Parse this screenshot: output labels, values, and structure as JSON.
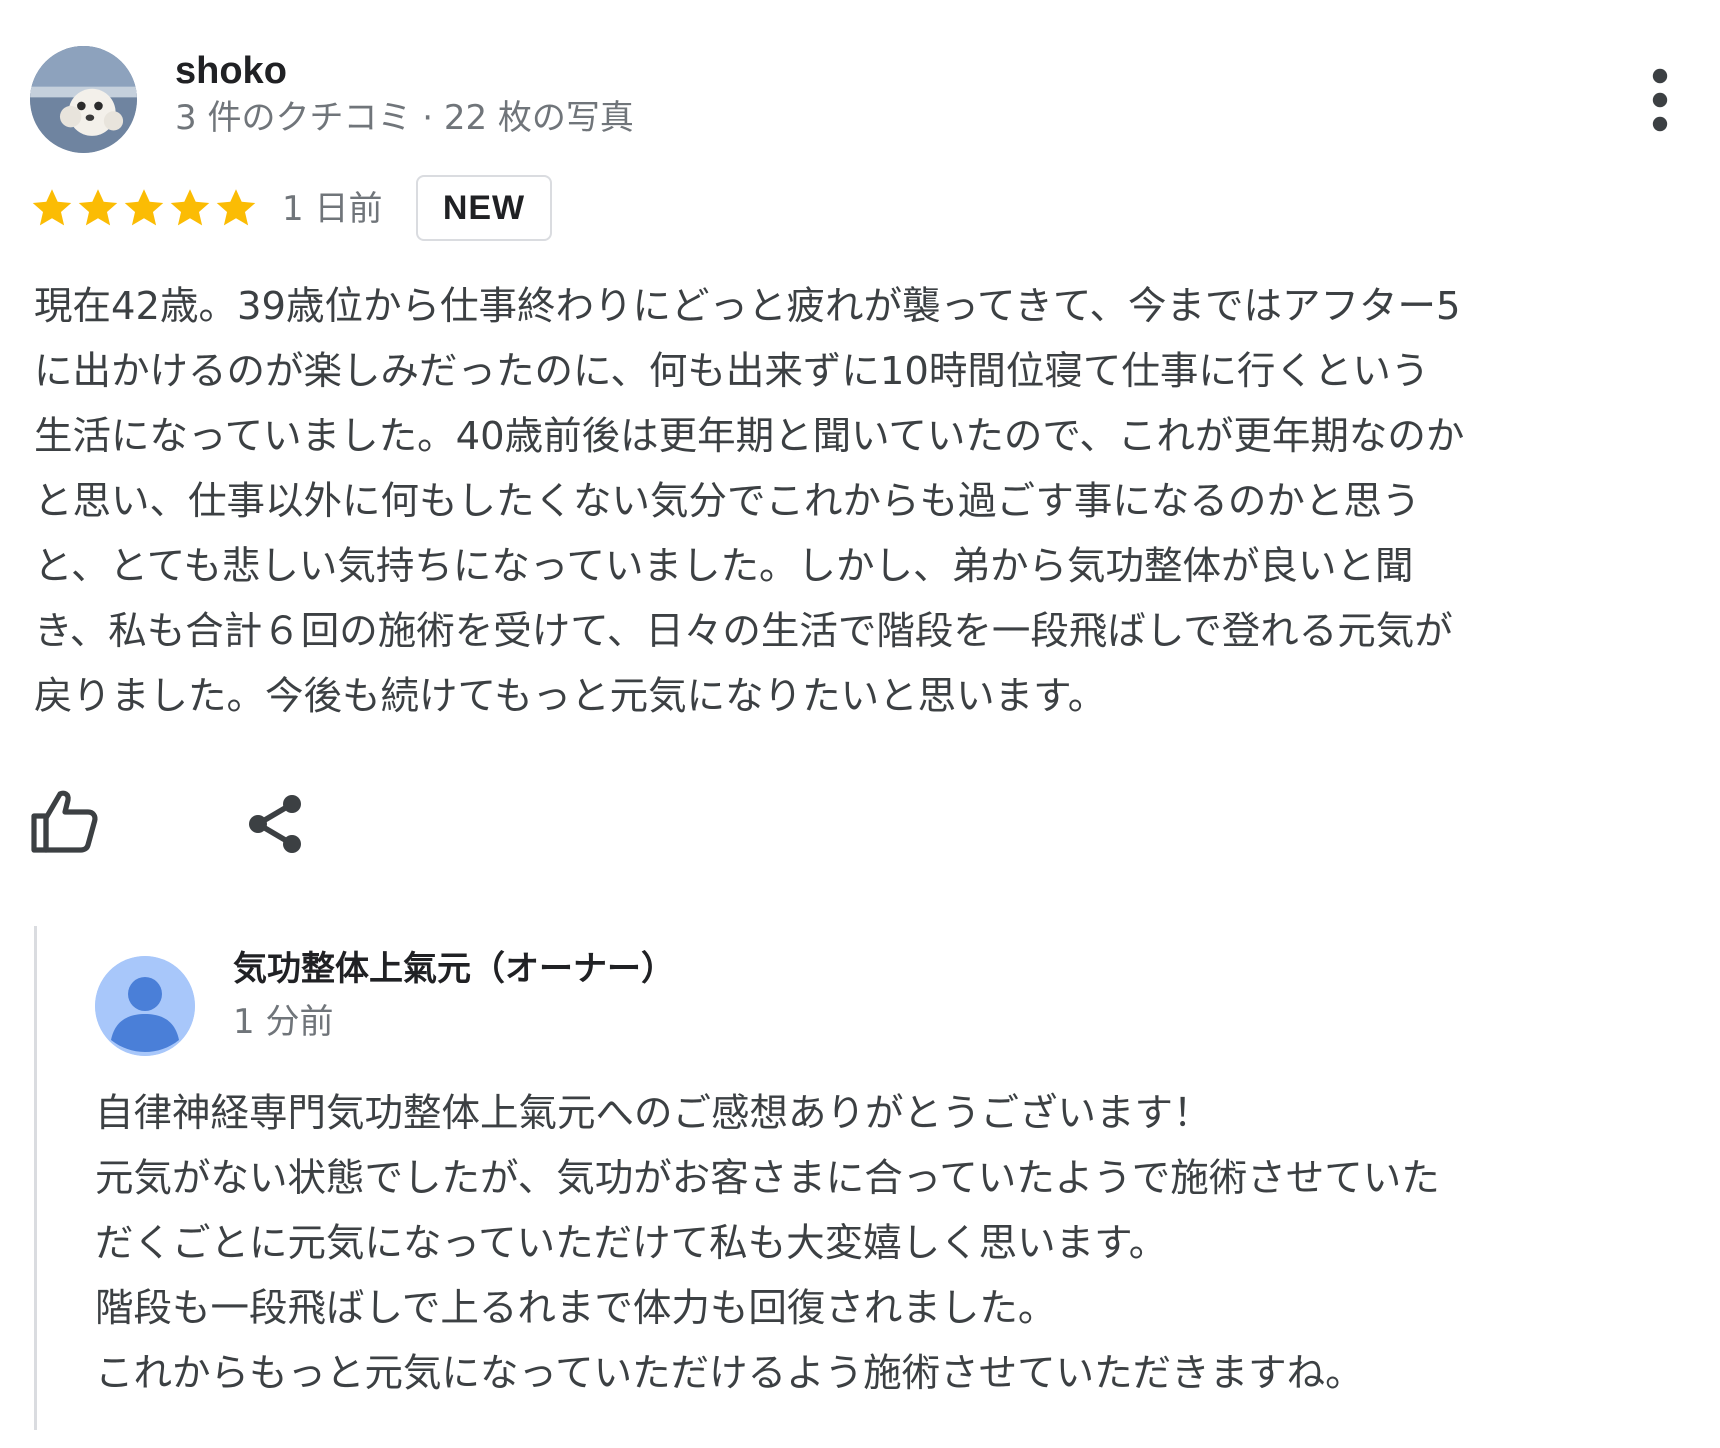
{
  "reviewer": {
    "name": "shoko",
    "meta": "3 件のクチコミ · 22 枚の写真"
  },
  "rating": {
    "stars": 5,
    "max_stars": 5,
    "star_color": "#fbbc04",
    "date": "1 日前",
    "badge": "NEW"
  },
  "review": {
    "lines": [
      "現在42歳。39歳位から仕事終わりにどっと疲れが襲ってきて、今まではアフター5",
      "に出かけるのが楽しみだったのに、何も出来ずに10時間位寝て仕事に行くという",
      "生活になっていました。40歳前後は更年期と聞いていたので、これが更年期なのか",
      "と思い、仕事以外に何もしたくない気分でこれからも過ごす事になるのかと思う",
      "と、とても悲しい気持ちになっていました。しかし、弟から気功整体が良いと聞",
      "き、私も合計６回の施術を受けて、日々の生活で階段を一段飛ばしで登れる元気が",
      "戻りました。今後も続けてもっと元気になりたいと思います。"
    ]
  },
  "actions": {
    "like_icon": "thumb-up-icon",
    "share_icon": "share-icon",
    "more_icon": "more-vert-icon"
  },
  "owner_reply": {
    "name": "気功整体上氣元（オーナー）",
    "date": "1 分前",
    "avatar_color": "#a8c7fa",
    "avatar_figure_color": "#4a7fd8",
    "lines": [
      "自律神経専門気功整体上氣元へのご感想ありがとうございます！",
      "元気がない状態でしたが、気功がお客さまに合っていたようで施術させていた",
      "だくごとに元気になっていただけて私も大変嬉しく思います。",
      "階段も一段飛ばしで上るれまで体力も回復されました。",
      "これからもっと元気になっていただけるよう施術させていただきますね。"
    ]
  }
}
